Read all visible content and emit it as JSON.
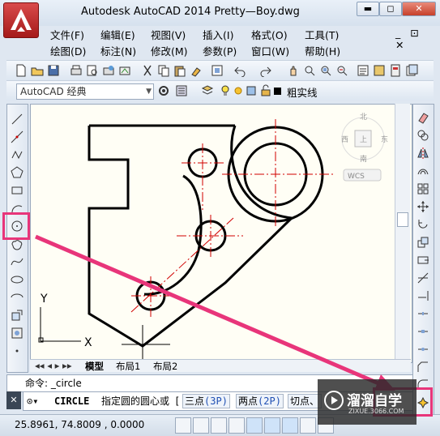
{
  "window": {
    "title": "Autodesk AutoCAD 2014      Pretty—Boy.dwg",
    "min": "▬",
    "restore": "◻",
    "close": "✕"
  },
  "menus": {
    "row1": [
      "文件(F)",
      "编辑(E)",
      "视图(V)",
      "插入(I)",
      "格式(O)",
      "工具(T)"
    ],
    "row2": [
      "绘图(D)",
      "标注(N)",
      "修改(M)",
      "参数(P)",
      "窗口(W)",
      "帮助(H)"
    ],
    "doc_controls": "_ ⊡ ✕"
  },
  "workspace_combo": {
    "value": "AutoCAD 经典"
  },
  "layer": {
    "name": "粗实线"
  },
  "viewcube": {
    "north": "北",
    "west": "西",
    "east": "东",
    "south": "南",
    "face": "上",
    "wcs": "WCS"
  },
  "ucs": {
    "y": "Y",
    "x": "X"
  },
  "layout_tabs": [
    "模型",
    "布局1",
    "布局2"
  ],
  "command": {
    "history": "命令: _circle",
    "prompt_cmd": "CIRCLE",
    "prompt_text": "指定圆的圆心或",
    "open_bracket": "[",
    "options": [
      {
        "label": "三点",
        "key": "(3P)"
      },
      {
        "label": "两点",
        "key": "(2P)"
      },
      {
        "label": "切点、",
        "key": ""
      }
    ]
  },
  "status": {
    "coords": "25.8961,   74.8009 , 0.0000"
  },
  "watermark": {
    "title": "溜溜自学",
    "sub": "ZIXUE.3066.COM"
  },
  "colors": {
    "highlight": "#e8357a",
    "drawing": "#000000",
    "centerline": "#d00000"
  }
}
